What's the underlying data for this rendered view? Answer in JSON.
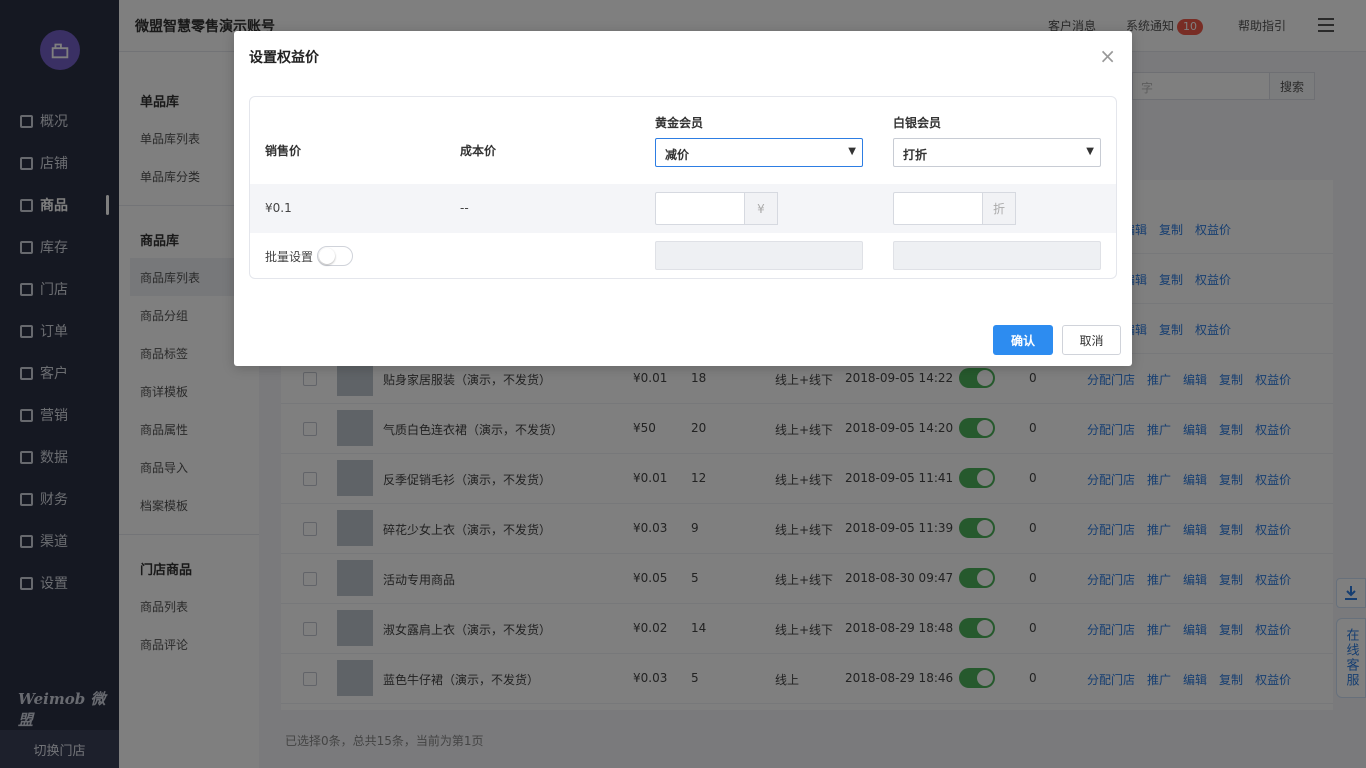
{
  "header": {
    "title": "微盟智慧零售演示账号",
    "links": [
      "客户消息",
      "系统通知",
      "帮助指引"
    ],
    "notice_count": "10"
  },
  "nav": {
    "items": [
      {
        "label": "概况",
        "icon": "dashboard-icon"
      },
      {
        "label": "店铺",
        "icon": "store-icon"
      },
      {
        "label": "商品",
        "icon": "goods-icon",
        "active": true
      },
      {
        "label": "库存",
        "icon": "inventory-icon"
      },
      {
        "label": "门店",
        "icon": "shop-icon"
      },
      {
        "label": "订单",
        "icon": "order-icon"
      },
      {
        "label": "客户",
        "icon": "customer-icon"
      },
      {
        "label": "营销",
        "icon": "marketing-icon"
      },
      {
        "label": "数据",
        "icon": "data-icon"
      },
      {
        "label": "财务",
        "icon": "finance-icon"
      },
      {
        "label": "渠道",
        "icon": "channel-icon"
      },
      {
        "label": "设置",
        "icon": "settings-icon"
      }
    ],
    "brand": "Weimob 微盟",
    "switch_store": "切换门店"
  },
  "subnav": {
    "group1": "单品库",
    "group1_items": [
      "单品库列表",
      "单品库分类"
    ],
    "group2": "商品库",
    "group2_items": [
      "商品库列表",
      "商品分组",
      "商品标签",
      "商详模板",
      "商品属性",
      "商品导入",
      "档案模板"
    ],
    "group3": "门店商品",
    "group3_items": [
      "商品列表",
      "商品评论"
    ]
  },
  "search": {
    "placeholder": "字",
    "button": "搜索"
  },
  "table": {
    "ops": [
      "分配门店",
      "推广",
      "编辑",
      "复制",
      "权益价"
    ],
    "rows": [
      {
        "name": "",
        "price": "",
        "stock": "",
        "channel": "",
        "date": "",
        "sales": ""
      },
      {
        "name": "",
        "price": "",
        "stock": "",
        "channel": "",
        "date": "",
        "sales": ""
      },
      {
        "name": "",
        "price": "",
        "stock": "",
        "channel": "",
        "date": "",
        "sales": ""
      },
      {
        "name": "贴身家居服装（演示，不发货）",
        "price": "¥0.01",
        "stock": "18",
        "channel": "线上+线下",
        "date": "2018-09-05 14:22",
        "sales": "0"
      },
      {
        "name": "气质白色连衣裙（演示，不发货）",
        "price": "¥50",
        "stock": "20",
        "channel": "线上+线下",
        "date": "2018-09-05 14:20",
        "sales": "0"
      },
      {
        "name": "反季促销毛衫（演示，不发货）",
        "price": "¥0.01",
        "stock": "12",
        "channel": "线上+线下",
        "date": "2018-09-05 11:41",
        "sales": "0"
      },
      {
        "name": "碎花少女上衣（演示，不发货）",
        "price": "¥0.03",
        "stock": "9",
        "channel": "线上+线下",
        "date": "2018-09-05 11:39",
        "sales": "0"
      },
      {
        "name": "活动专用商品",
        "price": "¥0.05",
        "stock": "5",
        "channel": "线上+线下",
        "date": "2018-08-30 09:47",
        "sales": "0"
      },
      {
        "name": "淑女露肩上衣（演示，不发货）",
        "price": "¥0.02",
        "stock": "14",
        "channel": "线上+线下",
        "date": "2018-08-29 18:48",
        "sales": "0"
      },
      {
        "name": "蓝色牛仔裙（演示，不发货）",
        "price": "¥0.03",
        "stock": "5",
        "channel": "线上",
        "date": "2018-08-29 18:46",
        "sales": "0"
      }
    ]
  },
  "footer": "已选择0条，总共15条，当前为第1页",
  "float": {
    "customer_service": "在线客服"
  },
  "modal": {
    "title": "设置权益价",
    "col_sale": "销售价",
    "col_cost": "成本价",
    "col_gold": "黄金会员",
    "col_silver": "白银会员",
    "gold_select": "减价",
    "silver_select": "打折",
    "sale_value": "¥0.1",
    "cost_value": "--",
    "gold_unit": "¥",
    "silver_unit": "折",
    "batch_label": "批量设置",
    "confirm": "确认",
    "cancel": "取消"
  }
}
